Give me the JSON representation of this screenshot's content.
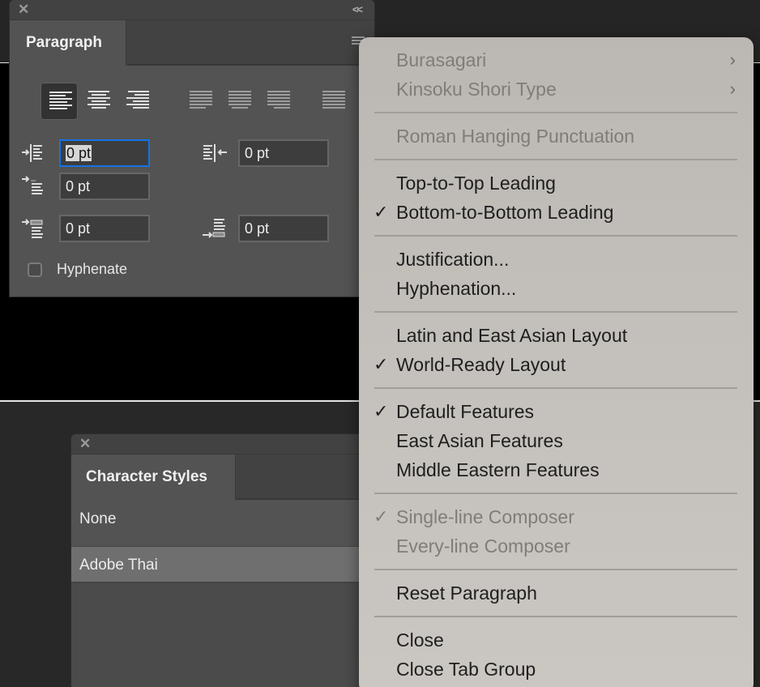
{
  "paragraph_panel": {
    "title": "Paragraph",
    "close_icon": "close-x-icon",
    "collapse_label": "<<",
    "alignment_buttons": [
      {
        "name": "align-left",
        "active": true
      },
      {
        "name": "align-center",
        "active": false
      },
      {
        "name": "align-right",
        "active": false
      },
      {
        "name": "justify-last-left",
        "active": false
      },
      {
        "name": "justify-last-center",
        "active": false
      },
      {
        "name": "justify-last-right",
        "active": false
      },
      {
        "name": "justify-all",
        "active": false
      }
    ],
    "fields": {
      "indent_left": "0 pt",
      "indent_right": "0 pt",
      "indent_first_line": "0 pt",
      "space_before": "0 pt",
      "space_after": "0 pt"
    },
    "hyphenate_label": "Hyphenate",
    "hyphenate_checked": false
  },
  "character_styles_panel": {
    "title": "Character Styles",
    "items": [
      "None",
      "Adobe Thai"
    ],
    "selected": "Adobe Thai"
  },
  "context_menu": {
    "groups": [
      [
        {
          "label": "Burasagari",
          "disabled": true,
          "checked": false,
          "submenu": true
        },
        {
          "label": "Kinsoku Shori Type",
          "disabled": true,
          "checked": false,
          "submenu": true
        }
      ],
      [
        {
          "label": "Roman Hanging Punctuation",
          "disabled": true,
          "checked": false,
          "submenu": false
        }
      ],
      [
        {
          "label": "Top-to-Top Leading",
          "disabled": false,
          "checked": false,
          "submenu": false
        },
        {
          "label": "Bottom-to-Bottom Leading",
          "disabled": false,
          "checked": true,
          "submenu": false
        }
      ],
      [
        {
          "label": "Justification...",
          "disabled": false,
          "checked": false,
          "submenu": false
        },
        {
          "label": "Hyphenation...",
          "disabled": false,
          "checked": false,
          "submenu": false
        }
      ],
      [
        {
          "label": "Latin and East Asian Layout",
          "disabled": false,
          "checked": false,
          "submenu": false
        },
        {
          "label": "World-Ready Layout",
          "disabled": false,
          "checked": true,
          "submenu": false
        }
      ],
      [
        {
          "label": "Default Features",
          "disabled": false,
          "checked": true,
          "submenu": false
        },
        {
          "label": "East Asian Features",
          "disabled": false,
          "checked": false,
          "submenu": false
        },
        {
          "label": "Middle Eastern Features",
          "disabled": false,
          "checked": false,
          "submenu": false
        }
      ],
      [
        {
          "label": "Single-line Composer",
          "disabled": true,
          "checked": true,
          "submenu": false
        },
        {
          "label": "Every-line Composer",
          "disabled": true,
          "checked": false,
          "submenu": false
        }
      ],
      [
        {
          "label": "Reset Paragraph",
          "disabled": false,
          "checked": false,
          "submenu": false
        }
      ],
      [
        {
          "label": "Close",
          "disabled": false,
          "checked": false,
          "submenu": false
        },
        {
          "label": "Close Tab Group",
          "disabled": false,
          "checked": false,
          "submenu": false
        }
      ]
    ],
    "check_glyph": "✓",
    "submenu_glyph": "›"
  }
}
